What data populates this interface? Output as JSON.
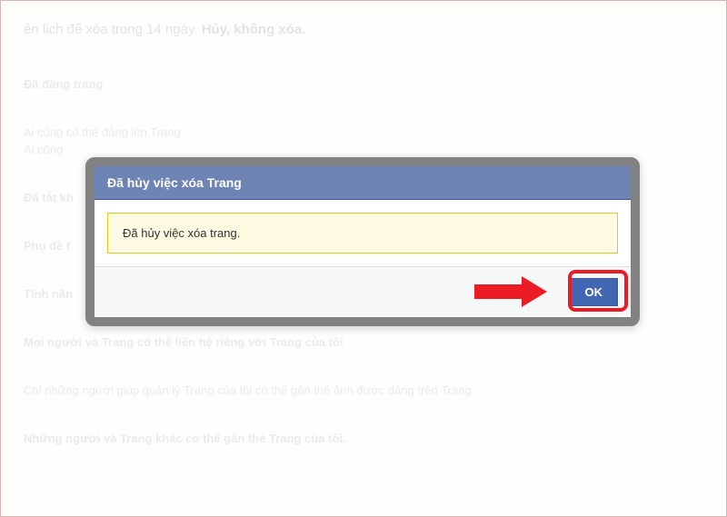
{
  "background": {
    "header_part1": "ên lịch để xóa trong 14 ngày. ",
    "header_part2": "Hủy, không xóa.",
    "lines": [
      "Đã đăng trang",
      "Ai cũng có thể đăng lên Trang.",
      "Ai cũng",
      "Đã tắt kh",
      "Phụ đề t",
      "Tính năn",
      "Mọi người và Trang có thể liên hệ riêng với Trang của tôi",
      "Chỉ những người giúp quản lý Trang của tôi có thể gắn thẻ ảnh được đăng trên Trang",
      "Những người và Trang khác có thể gắn thẻ Trang của tôi."
    ]
  },
  "dialog": {
    "title": "Đã hủy việc xóa Trang",
    "message": "Đã hủy việc xóa trang.",
    "ok_label": "OK"
  }
}
